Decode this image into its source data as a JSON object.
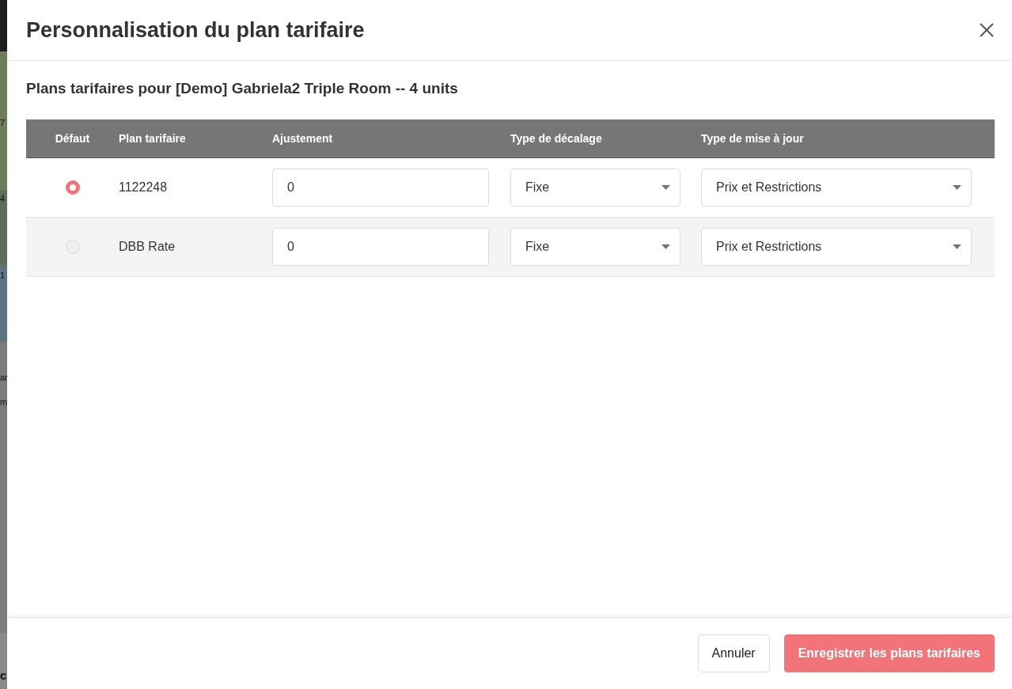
{
  "backdrop": {
    "fragments": [
      "7",
      "4",
      "1",
      "ar",
      "m",
      "c"
    ]
  },
  "dialog": {
    "title": "Personnalisation du plan tarifaire",
    "subtitle": "Plans tarifaires pour [Demo] Gabriela2 Triple Room -- 4 units"
  },
  "table": {
    "columns": [
      "Défaut",
      "Plan tarifaire",
      "Ajustement",
      "Type de décalage",
      "Type de mise à jour"
    ],
    "rows": [
      {
        "selected": true,
        "plan": "1122248",
        "adjustment": "0",
        "offset_type": "Fixe",
        "update_type": "Prix et Restrictions"
      },
      {
        "selected": false,
        "plan": "DBB Rate",
        "adjustment": "0",
        "offset_type": "Fixe",
        "update_type": "Prix et Restrictions"
      }
    ]
  },
  "buttons": [
    {
      "label": "Annuler",
      "kind": "secondary"
    },
    {
      "label": "Enregistrer les plans tarifaires",
      "kind": "primary"
    }
  ]
}
